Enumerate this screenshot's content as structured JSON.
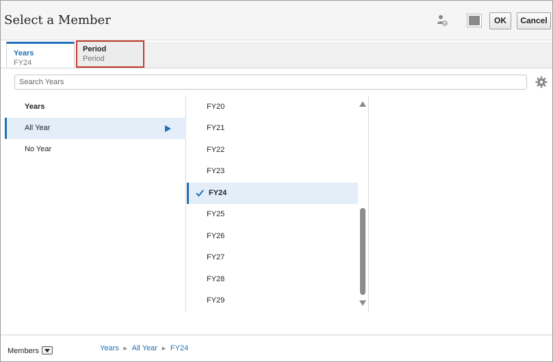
{
  "header": {
    "title": "Select a Member",
    "ok_label": "OK",
    "cancel_label": "Cancel"
  },
  "tabs": [
    {
      "label": "Years",
      "value": "FY24",
      "active": true
    },
    {
      "label": "Period",
      "value": "Period",
      "active": false
    }
  ],
  "search": {
    "placeholder": "Search Years"
  },
  "left_column": {
    "heading": "Years",
    "items": [
      {
        "label": "All Year",
        "selected": true
      },
      {
        "label": "No Year",
        "selected": false
      }
    ]
  },
  "members": {
    "items": [
      "FY20",
      "FY21",
      "FY22",
      "FY23",
      "FY24",
      "FY25",
      "FY26",
      "FY27",
      "FY28",
      "FY29"
    ],
    "selected": "FY24"
  },
  "footer": {
    "members_label": "Members",
    "breadcrumb": [
      "Years",
      "All Year",
      "FY24"
    ]
  },
  "colors": {
    "accent": "#1f6fb5",
    "selection_bg": "#e3eef9",
    "highlight_border": "#c0392b"
  }
}
